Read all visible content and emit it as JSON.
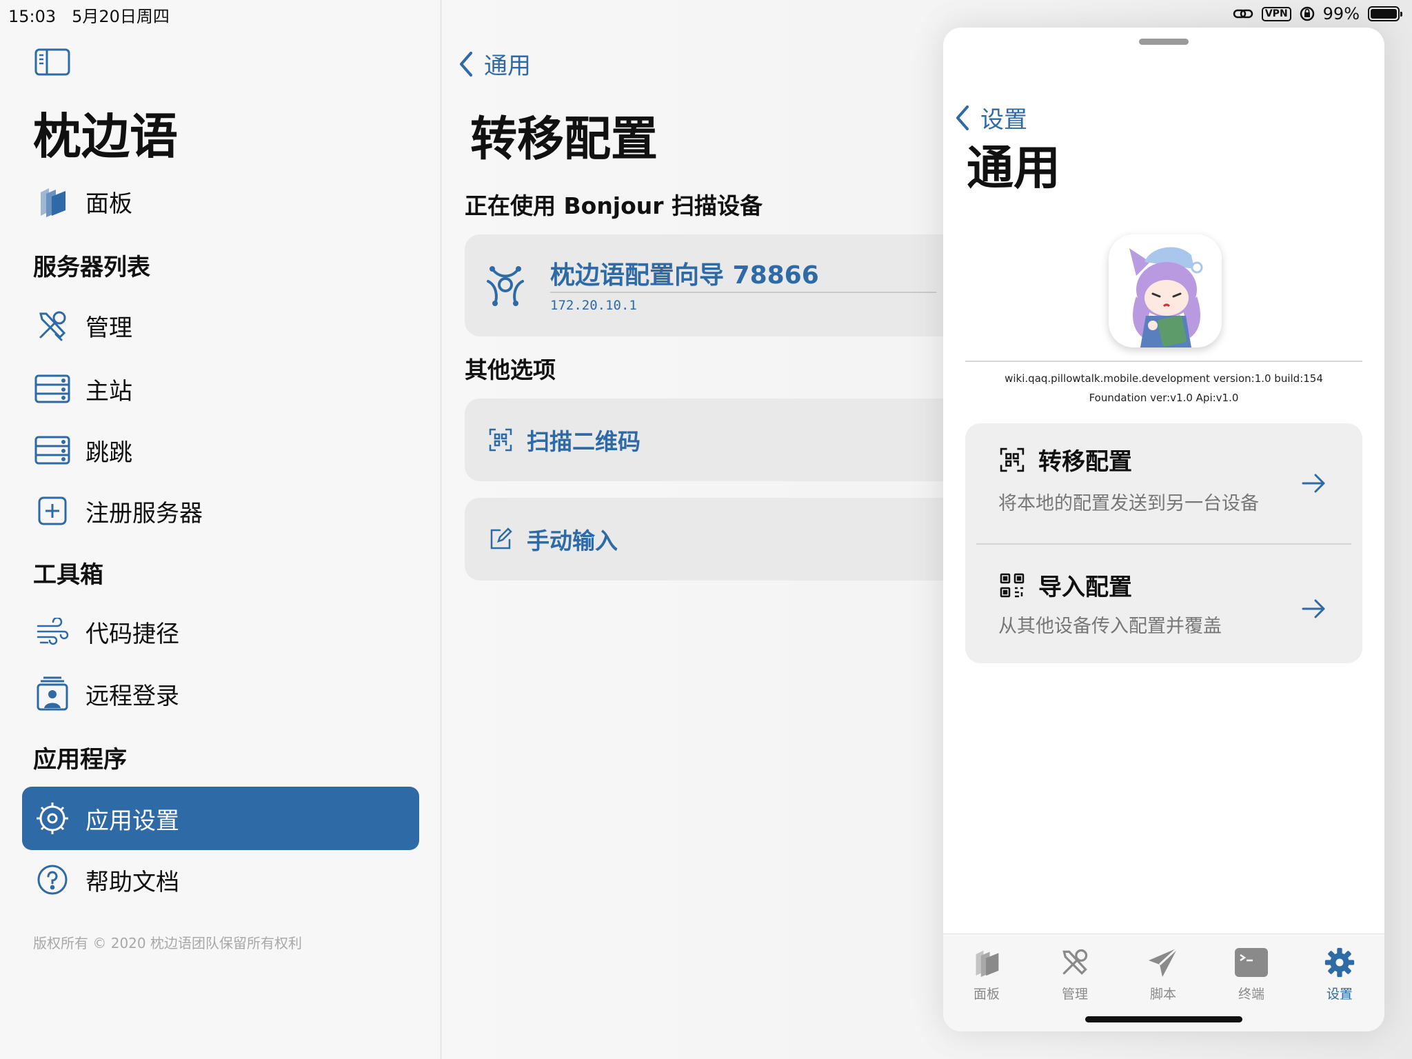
{
  "status": {
    "time": "15:03",
    "date": "5月20日周四",
    "vpn": "VPN",
    "battery": "99%",
    "battery_level": 0.99
  },
  "sidebar": {
    "title": "枕边语",
    "items": [
      {
        "label": "面板",
        "icon": "dashboard-icon"
      },
      {
        "label": "管理",
        "icon": "wrench-screwdriver-icon"
      },
      {
        "label": "主站",
        "icon": "server-icon"
      },
      {
        "label": "跳跳",
        "icon": "server-icon"
      },
      {
        "label": "注册服务器",
        "icon": "plus-square-icon"
      },
      {
        "label": "代码捷径",
        "icon": "wind-icon"
      },
      {
        "label": "远程登录",
        "icon": "contact-card-icon"
      },
      {
        "label": "应用设置",
        "icon": "gear-icon"
      },
      {
        "label": "帮助文档",
        "icon": "question-circle-icon"
      }
    ],
    "sections": [
      "服务器列表",
      "工具箱",
      "应用程序"
    ],
    "copyright": "版权所有 © 2020 枕边语团队保留所有权利"
  },
  "detail": {
    "back_label": "通用",
    "title": "转移配置",
    "scanning_text": "正在使用 Bonjour 扫描设备",
    "device": {
      "name": "枕边语配置向导 78866",
      "ip": "172.20.10.1"
    },
    "other_title": "其他选项",
    "options": [
      {
        "label": "扫描二维码",
        "icon": "qr-scan-icon"
      },
      {
        "label": "手动输入",
        "icon": "edit-icon"
      }
    ]
  },
  "sheet": {
    "back_label": "设置",
    "title": "通用",
    "version_line1": "wiki.qaq.pillowtalk.mobile.development version:1.0 build:154",
    "version_line2": "Foundation ver:v1.0 Api:v1.0",
    "rows": [
      {
        "title": "转移配置",
        "desc": "将本地的配置发送到另一台设备",
        "icon": "qr-scan-icon"
      },
      {
        "title": "导入配置",
        "desc": "从其他设备传入配置并覆盖",
        "icon": "qr-code-icon"
      }
    ],
    "tabs": [
      {
        "label": "面板",
        "icon": "dashboard-icon",
        "active": false
      },
      {
        "label": "管理",
        "icon": "wrench-screwdriver-icon",
        "active": false
      },
      {
        "label": "脚本",
        "icon": "paper-plane-icon",
        "active": false
      },
      {
        "label": "终端",
        "icon": "terminal-icon",
        "active": false
      },
      {
        "label": "设置",
        "icon": "gear-icon",
        "active": true
      }
    ]
  },
  "colors": {
    "accent": "#2e6aa6",
    "sidebar_bg": "#f7f7f7",
    "card_bg": "#e9e9e9"
  }
}
